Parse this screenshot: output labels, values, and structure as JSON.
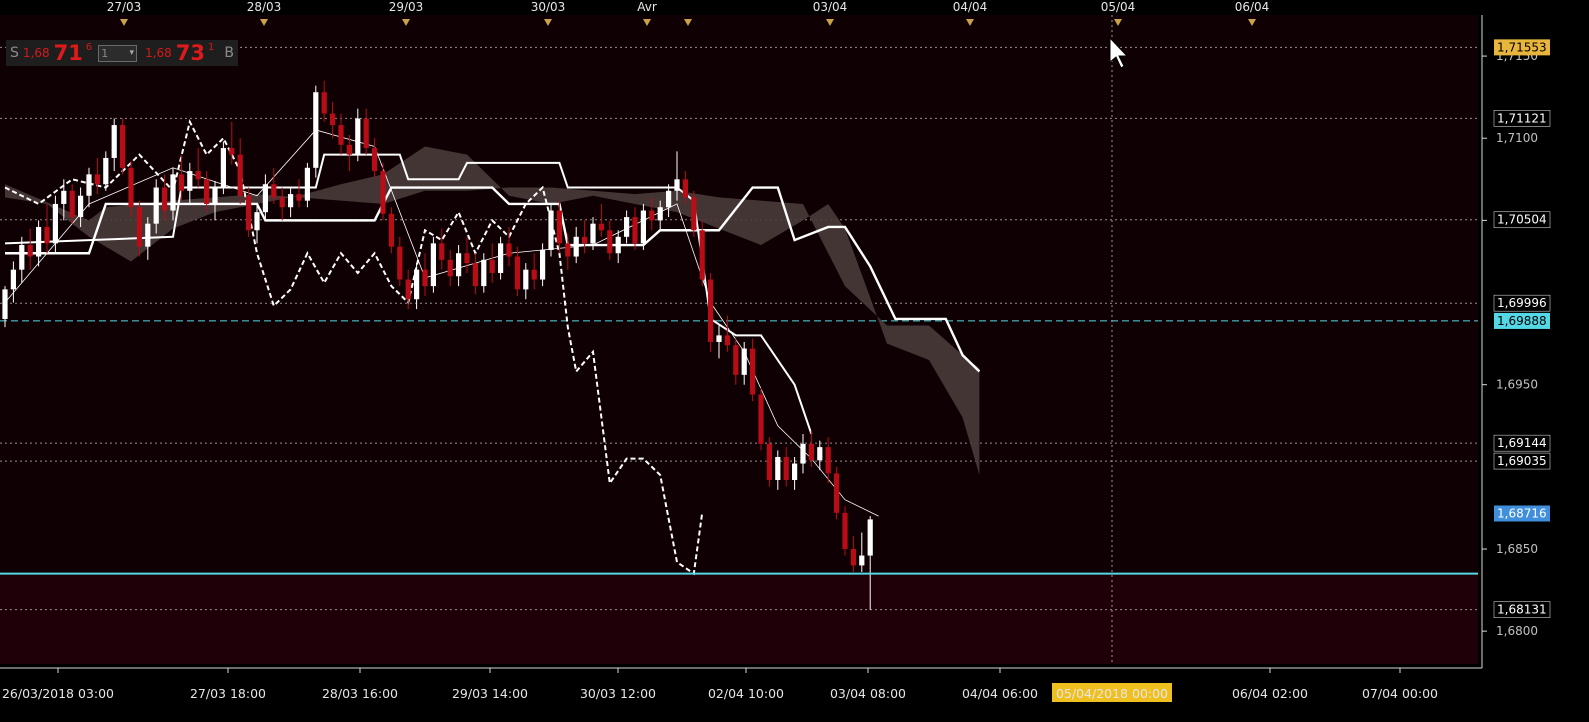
{
  "colors": {
    "background": "#000000",
    "plot_background": "#0f0003",
    "lower_zone": "#200008",
    "grid": "#b4b4b4",
    "bull_candle": "#ffffff",
    "bear_candle": "#b80d17",
    "ichimoku_line": "#ffffff",
    "kumo_fill": "#4a3b3b",
    "support_line": "#55d8e6",
    "current_price_bg": "#3f8fdc",
    "last_price_bg": "#e8b63c",
    "cursor_time_bg": "#f0c020"
  },
  "quote_panel": {
    "sell_label": "S",
    "bid_prefix": "1,68",
    "bid_big": "71",
    "bid_sup": "6",
    "qty_value": "1",
    "ask_prefix": "1,68",
    "ask_big": "73",
    "ask_sup": "1",
    "buy_label": "B"
  },
  "chart_data": {
    "type": "candlestick",
    "top_axis_labels": [
      "27/03",
      "28/03",
      "29/03",
      "30/03",
      "Avr",
      "03/04",
      "04/04",
      "05/04",
      "06/04"
    ],
    "bottom_axis_labels": [
      "26/03/2018 03:00",
      "27/03 18:00",
      "28/03 16:00",
      "29/03 14:00",
      "30/03 12:00",
      "02/04 10:00",
      "03/04 08:00",
      "04/04 06:00",
      "06/04 02:00",
      "07/04 00:00"
    ],
    "cursor_time_label": "05/04/2018 00:00",
    "price_scale_labels": [
      "1,7150",
      "1,7100",
      "1,7050",
      "1,6950",
      "1,6850",
      "1,6800"
    ],
    "ylim": [
      1.678,
      1.7175
    ],
    "price_markers": [
      {
        "label": "1,71553",
        "value": 1.71553,
        "style": "last"
      },
      {
        "label": "1,71121",
        "value": 1.71121,
        "style": "plain"
      },
      {
        "label": "1,70504",
        "value": 1.70504,
        "style": "plain"
      },
      {
        "label": "1,69996",
        "value": 1.69996,
        "style": "plain"
      },
      {
        "label": "1,69888",
        "value": 1.69888,
        "style": "support"
      },
      {
        "label": "1,69144",
        "value": 1.69144,
        "style": "plain"
      },
      {
        "label": "1,69035",
        "value": 1.69035,
        "style": "plain"
      },
      {
        "label": "1,68716",
        "value": 1.68716,
        "style": "current"
      },
      {
        "label": "1,68131",
        "value": 1.68131,
        "style": "plain"
      }
    ],
    "support_price": 1.6835,
    "candles": [
      [
        1.699,
        1.701,
        1.6985,
        1.7008
      ],
      [
        1.7008,
        1.7025,
        1.7,
        1.702
      ],
      [
        1.702,
        1.704,
        1.7012,
        1.7035
      ],
      [
        1.7035,
        1.7045,
        1.702,
        1.7028
      ],
      [
        1.7028,
        1.705,
        1.7022,
        1.7046
      ],
      [
        1.7046,
        1.706,
        1.703,
        1.7036
      ],
      [
        1.7036,
        1.7065,
        1.703,
        1.706
      ],
      [
        1.706,
        1.7075,
        1.705,
        1.7068
      ],
      [
        1.7068,
        1.7072,
        1.7048,
        1.7052
      ],
      [
        1.7052,
        1.707,
        1.7046,
        1.7065
      ],
      [
        1.7065,
        1.7082,
        1.7058,
        1.7078
      ],
      [
        1.7078,
        1.7088,
        1.7066,
        1.7072
      ],
      [
        1.7072,
        1.7092,
        1.7068,
        1.7088
      ],
      [
        1.7088,
        1.7112,
        1.708,
        1.7108
      ],
      [
        1.7108,
        1.7112,
        1.7078,
        1.7082
      ],
      [
        1.7082,
        1.7086,
        1.7052,
        1.7058
      ],
      [
        1.7058,
        1.7062,
        1.7028,
        1.7034
      ],
      [
        1.7034,
        1.7052,
        1.7026,
        1.7048
      ],
      [
        1.7048,
        1.7075,
        1.7042,
        1.707
      ],
      [
        1.707,
        1.7078,
        1.705,
        1.7056
      ],
      [
        1.7056,
        1.7082,
        1.705,
        1.7078
      ],
      [
        1.7078,
        1.709,
        1.7062,
        1.7068
      ],
      [
        1.7068,
        1.7085,
        1.706,
        1.708
      ],
      [
        1.708,
        1.7094,
        1.707,
        1.7075
      ],
      [
        1.7075,
        1.708,
        1.7055,
        1.706
      ],
      [
        1.706,
        1.7074,
        1.705,
        1.707
      ],
      [
        1.707,
        1.7098,
        1.7066,
        1.7094
      ],
      [
        1.7094,
        1.711,
        1.7084,
        1.709
      ],
      [
        1.709,
        1.71,
        1.706,
        1.7065
      ],
      [
        1.7065,
        1.707,
        1.704,
        1.7044
      ],
      [
        1.7044,
        1.706,
        1.7036,
        1.7055
      ],
      [
        1.7055,
        1.7078,
        1.705,
        1.7072
      ],
      [
        1.7072,
        1.7082,
        1.706,
        1.7064
      ],
      [
        1.7064,
        1.707,
        1.705,
        1.7058
      ],
      [
        1.7058,
        1.707,
        1.7052,
        1.7066
      ],
      [
        1.7066,
        1.7075,
        1.7058,
        1.7062
      ],
      [
        1.7062,
        1.7085,
        1.7058,
        1.7082
      ],
      [
        1.7082,
        1.7132,
        1.7076,
        1.7128
      ],
      [
        1.7128,
        1.7135,
        1.711,
        1.7115
      ],
      [
        1.7115,
        1.7122,
        1.71,
        1.7108
      ],
      [
        1.7108,
        1.7115,
        1.709,
        1.7096
      ],
      [
        1.7096,
        1.7102,
        1.708,
        1.709
      ],
      [
        1.709,
        1.7118,
        1.7086,
        1.7112
      ],
      [
        1.7112,
        1.7118,
        1.709,
        1.7094
      ],
      [
        1.7094,
        1.71,
        1.7076,
        1.708
      ],
      [
        1.708,
        1.7085,
        1.705,
        1.7054
      ],
      [
        1.7054,
        1.7058,
        1.703,
        1.7034
      ],
      [
        1.7034,
        1.704,
        1.701,
        1.7014
      ],
      [
        1.7014,
        1.702,
        1.6996,
        1.7002
      ],
      [
        1.7002,
        1.7024,
        1.6996,
        1.702
      ],
      [
        1.702,
        1.703,
        1.7004,
        1.701
      ],
      [
        1.701,
        1.704,
        1.7006,
        1.7036
      ],
      [
        1.7036,
        1.7045,
        1.702,
        1.7026
      ],
      [
        1.7026,
        1.7032,
        1.701,
        1.7016
      ],
      [
        1.7016,
        1.7035,
        1.701,
        1.703
      ],
      [
        1.703,
        1.704,
        1.7018,
        1.7024
      ],
      [
        1.7024,
        1.703,
        1.7005,
        1.701
      ],
      [
        1.701,
        1.703,
        1.7006,
        1.7026
      ],
      [
        1.7026,
        1.7036,
        1.7012,
        1.7018
      ],
      [
        1.7018,
        1.704,
        1.7014,
        1.7036
      ],
      [
        1.7036,
        1.7046,
        1.7022,
        1.7028
      ],
      [
        1.7028,
        1.7034,
        1.7004,
        1.7008
      ],
      [
        1.7008,
        1.7024,
        1.7002,
        1.702
      ],
      [
        1.702,
        1.703,
        1.7008,
        1.7014
      ],
      [
        1.7014,
        1.7036,
        1.701,
        1.7032
      ],
      [
        1.7032,
        1.706,
        1.7028,
        1.7056
      ],
      [
        1.7056,
        1.7062,
        1.703,
        1.7036
      ],
      [
        1.7036,
        1.7042,
        1.702,
        1.7028
      ],
      [
        1.7028,
        1.7046,
        1.7024,
        1.704
      ],
      [
        1.704,
        1.705,
        1.703,
        1.7036
      ],
      [
        1.7036,
        1.7052,
        1.7032,
        1.7048
      ],
      [
        1.7048,
        1.706,
        1.704,
        1.7044
      ],
      [
        1.7044,
        1.705,
        1.7026,
        1.703
      ],
      [
        1.703,
        1.7044,
        1.7024,
        1.704
      ],
      [
        1.704,
        1.7056,
        1.7036,
        1.7052
      ],
      [
        1.7052,
        1.7058,
        1.7032,
        1.7036
      ],
      [
        1.7036,
        1.706,
        1.7032,
        1.7056
      ],
      [
        1.7056,
        1.7064,
        1.7044,
        1.705
      ],
      [
        1.705,
        1.7062,
        1.7044,
        1.7058
      ],
      [
        1.7058,
        1.7072,
        1.7052,
        1.7068
      ],
      [
        1.7068,
        1.7092,
        1.7062,
        1.7075
      ],
      [
        1.7075,
        1.708,
        1.706,
        1.7064
      ],
      [
        1.7064,
        1.7068,
        1.704,
        1.7044
      ],
      [
        1.7044,
        1.705,
        1.701,
        1.7014
      ],
      [
        1.7014,
        1.7018,
        1.697,
        1.6976
      ],
      [
        1.6976,
        1.6986,
        1.6966,
        1.698
      ],
      [
        1.698,
        1.6992,
        1.697,
        1.6974
      ],
      [
        1.6974,
        1.6978,
        1.695,
        1.6956
      ],
      [
        1.6956,
        1.6976,
        1.695,
        1.6972
      ],
      [
        1.6972,
        1.6978,
        1.694,
        1.6944
      ],
      [
        1.6944,
        1.6948,
        1.691,
        1.6914
      ],
      [
        1.6914,
        1.6918,
        1.6888,
        1.6892
      ],
      [
        1.6892,
        1.691,
        1.6886,
        1.6906
      ],
      [
        1.6906,
        1.6912,
        1.6888,
        1.6892
      ],
      [
        1.6892,
        1.6906,
        1.6886,
        1.6902
      ],
      [
        1.6902,
        1.692,
        1.6896,
        1.6914
      ],
      [
        1.6914,
        1.6922,
        1.69,
        1.6904
      ],
      [
        1.6904,
        1.6916,
        1.6898,
        1.6912
      ],
      [
        1.6912,
        1.6918,
        1.689,
        1.6896
      ],
      [
        1.6896,
        1.69,
        1.6868,
        1.6872
      ],
      [
        1.6872,
        1.6876,
        1.6846,
        1.685
      ],
      [
        1.685,
        1.6858,
        1.6836,
        1.684
      ],
      [
        1.684,
        1.686,
        1.6836,
        1.6846
      ],
      [
        1.6846,
        1.687,
        1.6813,
        1.6868
      ]
    ],
    "ichimoku": {
      "tenkan": [
        [
          0,
          1.7036
        ],
        [
          20,
          1.704
        ],
        [
          21,
          1.707
        ],
        [
          37,
          1.707
        ],
        [
          38,
          1.709
        ],
        [
          47,
          1.709
        ],
        [
          48,
          1.7075
        ],
        [
          54,
          1.7075
        ],
        [
          55,
          1.7085
        ],
        [
          66,
          1.7085
        ],
        [
          67,
          1.707
        ],
        [
          80,
          1.707
        ],
        [
          82,
          1.7062
        ],
        [
          84,
          1.699
        ],
        [
          87,
          1.698
        ],
        [
          90,
          1.698
        ],
        [
          94,
          1.695
        ],
        [
          96,
          1.692
        ]
      ],
      "kijun": [
        [
          0,
          1.703
        ],
        [
          10,
          1.703
        ],
        [
          12,
          1.706
        ],
        [
          30,
          1.706
        ],
        [
          31,
          1.705
        ],
        [
          44,
          1.705
        ],
        [
          46,
          1.707
        ],
        [
          58,
          1.707
        ],
        [
          60,
          1.706
        ],
        [
          66,
          1.706
        ],
        [
          67,
          1.7035
        ],
        [
          76,
          1.7035
        ],
        [
          78,
          1.7044
        ],
        [
          85,
          1.7044
        ],
        [
          89,
          1.707
        ],
        [
          92,
          1.707
        ],
        [
          94,
          1.7038
        ],
        [
          98,
          1.7046
        ],
        [
          100,
          1.7046
        ],
        [
          103,
          1.7022
        ],
        [
          106,
          1.699
        ],
        [
          112,
          1.699
        ],
        [
          114,
          1.6968
        ],
        [
          116,
          1.6958
        ]
      ],
      "chikou": [
        [
          0,
          1.707
        ],
        [
          4,
          1.706
        ],
        [
          8,
          1.7075
        ],
        [
          12,
          1.707
        ],
        [
          16,
          1.709
        ],
        [
          20,
          1.7068
        ],
        [
          22,
          1.711
        ],
        [
          24,
          1.709
        ],
        [
          26,
          1.71
        ],
        [
          28,
          1.708
        ],
        [
          30,
          1.703
        ],
        [
          32,
          1.6998
        ],
        [
          34,
          1.7008
        ],
        [
          36,
          1.703
        ],
        [
          38,
          1.7012
        ],
        [
          40,
          1.703
        ],
        [
          42,
          1.7018
        ],
        [
          44,
          1.703
        ],
        [
          46,
          1.701
        ],
        [
          48,
          1.7
        ],
        [
          50,
          1.7044
        ],
        [
          52,
          1.7038
        ],
        [
          54,
          1.7055
        ],
        [
          56,
          1.703
        ],
        [
          58,
          1.705
        ],
        [
          60,
          1.704
        ],
        [
          62,
          1.706
        ],
        [
          64,
          1.707
        ],
        [
          66,
          1.703
        ],
        [
          67,
          1.6985
        ],
        [
          68,
          1.6958
        ],
        [
          70,
          1.697
        ],
        [
          72,
          1.689
        ],
        [
          74,
          1.6905
        ],
        [
          76,
          1.6905
        ],
        [
          78,
          1.6895
        ],
        [
          80,
          1.6842
        ],
        [
          82,
          1.6835
        ],
        [
          83,
          1.6872
        ]
      ],
      "kumo_a": [
        [
          0,
          1.7064
        ],
        [
          5,
          1.706
        ],
        [
          10,
          1.704
        ],
        [
          15,
          1.7025
        ],
        [
          20,
          1.7045
        ],
        [
          25,
          1.7055
        ],
        [
          30,
          1.706
        ],
        [
          35,
          1.7065
        ],
        [
          40,
          1.7072
        ],
        [
          45,
          1.7078
        ],
        [
          50,
          1.7095
        ],
        [
          55,
          1.709
        ],
        [
          60,
          1.7065
        ],
        [
          65,
          1.706
        ],
        [
          70,
          1.7065
        ],
        [
          75,
          1.706
        ],
        [
          80,
          1.7055
        ],
        [
          85,
          1.7045
        ],
        [
          90,
          1.7035
        ],
        [
          95,
          1.705
        ],
        [
          98,
          1.706
        ],
        [
          100,
          1.7045
        ],
        [
          105,
          1.6975
        ],
        [
          110,
          1.6965
        ],
        [
          114,
          1.693
        ],
        [
          116,
          1.6895
        ]
      ],
      "kumo_b": [
        [
          0,
          1.7072
        ],
        [
          10,
          1.705
        ],
        [
          12,
          1.7058
        ],
        [
          20,
          1.7062
        ],
        [
          30,
          1.7066
        ],
        [
          40,
          1.7062
        ],
        [
          45,
          1.706
        ],
        [
          50,
          1.7068
        ],
        [
          55,
          1.7068
        ],
        [
          60,
          1.707
        ],
        [
          65,
          1.707
        ],
        [
          70,
          1.7068
        ],
        [
          75,
          1.7066
        ],
        [
          80,
          1.7068
        ],
        [
          85,
          1.7064
        ],
        [
          90,
          1.7062
        ],
        [
          95,
          1.706
        ],
        [
          100,
          1.701
        ],
        [
          105,
          1.6986
        ],
        [
          110,
          1.6986
        ],
        [
          114,
          1.6968
        ],
        [
          116,
          1.696
        ]
      ],
      "close_line": [
        [
          0,
          1.7
        ],
        [
          10,
          1.706
        ],
        [
          20,
          1.7082
        ],
        [
          30,
          1.7065
        ],
        [
          37,
          1.7105
        ],
        [
          44,
          1.7095
        ],
        [
          50,
          1.7015
        ],
        [
          60,
          1.703
        ],
        [
          70,
          1.7035
        ],
        [
          80,
          1.706
        ],
        [
          84,
          1.7
        ],
        [
          88,
          1.697
        ],
        [
          92,
          1.6925
        ],
        [
          96,
          1.6905
        ],
        [
          100,
          1.688
        ],
        [
          104,
          1.687
        ]
      ]
    }
  }
}
